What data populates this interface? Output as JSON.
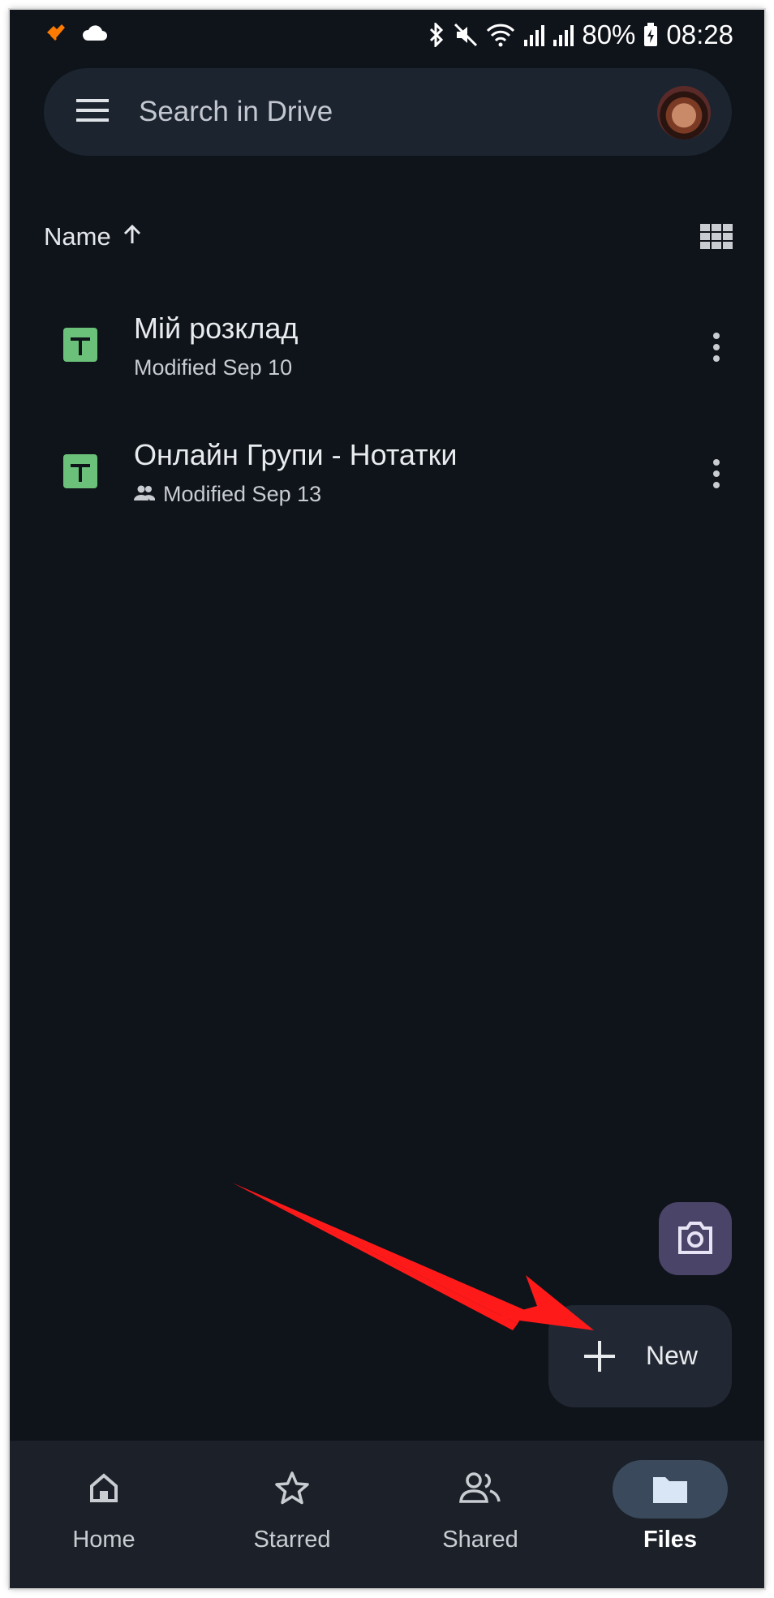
{
  "status_bar": {
    "battery": "80%",
    "time": "08:28",
    "icons": [
      "heart-rate-app-icon",
      "cloud-icon",
      "bluetooth-icon",
      "mute-icon",
      "wifi-icon",
      "signal-icon",
      "signal-icon",
      "battery-charging-icon"
    ]
  },
  "search": {
    "placeholder": "Search in Drive"
  },
  "sort": {
    "label": "Name"
  },
  "files": [
    {
      "title": "Мій розклад",
      "meta": "Modified Sep 10",
      "shared": false,
      "type": "sheets"
    },
    {
      "title": "Онлайн Групи - Нотатки",
      "meta": "Modified Sep 13",
      "shared": true,
      "type": "sheets"
    }
  ],
  "fab": {
    "new_label": "New"
  },
  "nav": {
    "items": [
      {
        "label": "Home",
        "icon": "home-icon",
        "active": false
      },
      {
        "label": "Starred",
        "icon": "star-icon",
        "active": false
      },
      {
        "label": "Shared",
        "icon": "people-icon",
        "active": false
      },
      {
        "label": "Files",
        "icon": "folder-icon",
        "active": true
      }
    ]
  },
  "colors": {
    "background": "#0f131a",
    "search_bg": "#1c2430",
    "sheets_green": "#6bc17a",
    "arrow_red": "#ff0000",
    "camera_fab": "#4a4468"
  }
}
